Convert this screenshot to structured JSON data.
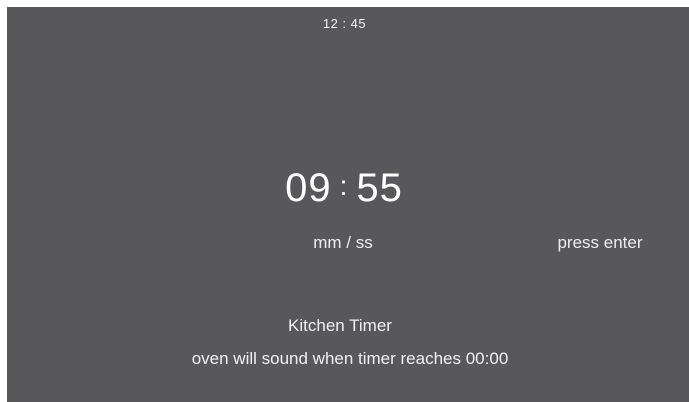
{
  "header": {
    "clock_time": "12 : 45"
  },
  "timer": {
    "minutes": "09",
    "separator": ":",
    "seconds": "55",
    "units_label": "mm / ss",
    "hint": "press enter"
  },
  "footer": {
    "title": "Kitchen Timer",
    "subtitle": "oven will sound when timer reaches 00:00"
  },
  "colors": {
    "background": "#58585a",
    "text": "#ffffff"
  }
}
